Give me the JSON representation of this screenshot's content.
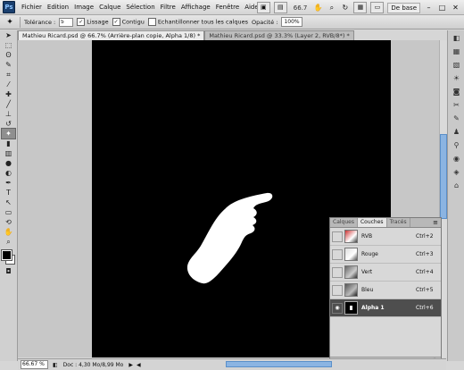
{
  "menubar": {
    "logo": "Ps",
    "items": [
      "Fichier",
      "Edition",
      "Image",
      "Calque",
      "Sélection",
      "Filtre",
      "Affichage",
      "Fenêtre",
      "Aide"
    ],
    "zoom": "66.7",
    "workspace": "De base"
  },
  "options": {
    "tolerance_label": "Tolérance :",
    "tolerance_value": "5",
    "lissage": "Lissage",
    "contigu": "Contigu",
    "echantillonner": "Echantillonner tous les calques",
    "opacite_label": "Opacité :",
    "opacite_value": "100%"
  },
  "tabs": [
    "Mathieu Ricard.psd @ 66.7% (Arrière-plan copie, Alpha 1/8) *",
    "Mathieu Ricard.psd @ 33.3% (Layer 2, RVB/8*) *"
  ],
  "panel": {
    "tabs": [
      "Calques",
      "Couches",
      "Tracés"
    ],
    "channels": [
      {
        "name": "RVB",
        "shortcut": "Ctrl+2"
      },
      {
        "name": "Rouge",
        "shortcut": "Ctrl+3"
      },
      {
        "name": "Vert",
        "shortcut": "Ctrl+4"
      },
      {
        "name": "Bleu",
        "shortcut": "Ctrl+5"
      },
      {
        "name": "Alpha 1",
        "shortcut": "Ctrl+6"
      }
    ]
  },
  "status": {
    "zoom": "66.67 %",
    "doc": "Doc : 4,30 Mo/8,99 Mo"
  },
  "colors": {
    "accent": "#8bb4e2",
    "canvas": "#000000",
    "selection": "#4e4e4e"
  }
}
